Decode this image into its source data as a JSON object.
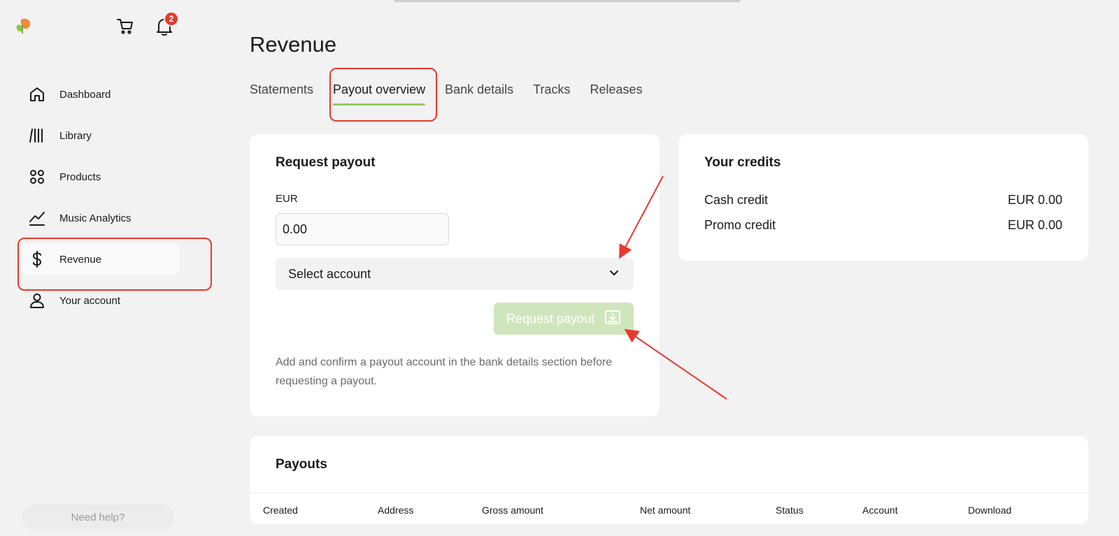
{
  "header": {
    "notification_count": "2"
  },
  "sidebar": {
    "items": [
      {
        "label": "Dashboard",
        "icon": "home-icon"
      },
      {
        "label": "Library",
        "icon": "library-icon"
      },
      {
        "label": "Products",
        "icon": "products-icon"
      },
      {
        "label": "Music Analytics",
        "icon": "analytics-icon"
      },
      {
        "label": "Revenue",
        "icon": "dollar-icon",
        "active": true
      },
      {
        "label": "Your account",
        "icon": "user-icon"
      }
    ],
    "help_label": "Need help?"
  },
  "main": {
    "title": "Revenue",
    "tabs": [
      {
        "label": "Statements"
      },
      {
        "label": "Payout overview",
        "active": true
      },
      {
        "label": "Bank details"
      },
      {
        "label": "Tracks"
      },
      {
        "label": "Releases"
      }
    ]
  },
  "request_payout": {
    "title": "Request payout",
    "currency_label": "EUR",
    "amount_value": "0.00",
    "select_placeholder": "Select account",
    "button_label": "Request payout",
    "note": "Add and confirm a payout account in the bank details section before requesting a payout."
  },
  "credits": {
    "title": "Your credits",
    "rows": [
      {
        "label": "Cash credit",
        "value": "EUR 0.00"
      },
      {
        "label": "Promo credit",
        "value": "EUR 0.00"
      }
    ]
  },
  "payouts": {
    "title": "Payouts",
    "columns": [
      "Created",
      "Address",
      "Gross amount",
      "Net amount",
      "Status",
      "Account",
      "Download"
    ]
  },
  "colors": {
    "accent_green": "#95c865",
    "disabled_button": "#cfe6bc",
    "highlight_red": "#e8392d",
    "background": "#f2f2f2"
  }
}
